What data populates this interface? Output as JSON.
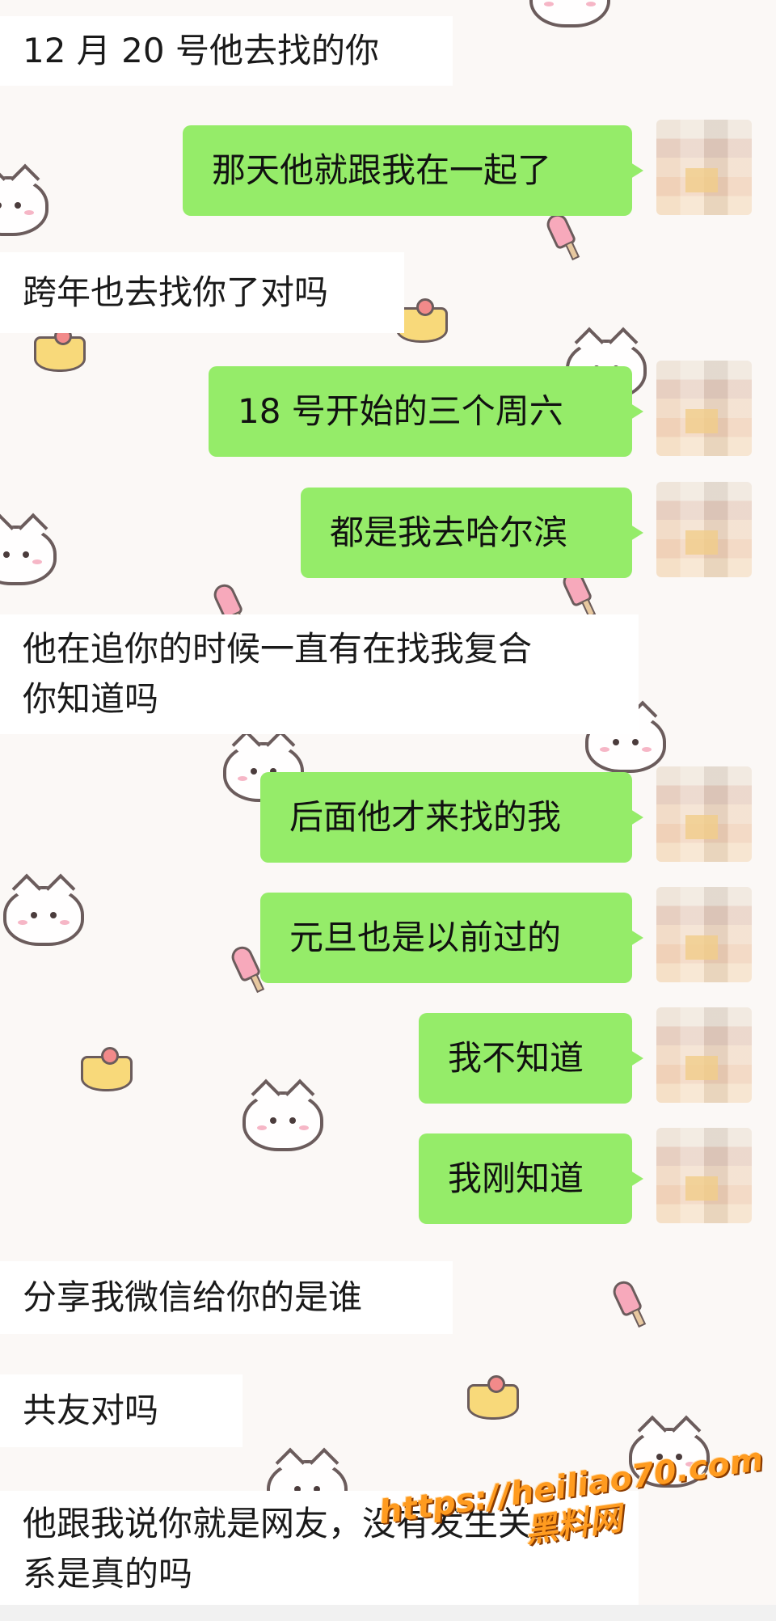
{
  "messages": {
    "m1": "12 月 20 号他去找的你",
    "m2": "那天他就跟我在一起了",
    "m3": "跨年也去找你了对吗",
    "m4": "18 号开始的三个周六",
    "m5": "都是我去哈尔滨",
    "m6_line1": "他在追你的时候一直有在找我复合",
    "m6_line2": "你知道吗",
    "m7": "后面他才来找的我",
    "m8": "元旦也是以前过的",
    "m9": "我不知道",
    "m10": "我刚知道",
    "m11": "分享我微信给你的是谁",
    "m12": "共友对吗",
    "m13_line1": "他跟我说你就是网友，没有发生关",
    "m13_line2": "系是真的吗"
  },
  "watermark": {
    "url": "https://heiliao70.com",
    "site": "黑料网"
  },
  "colors": {
    "outgoing_bubble": "#95ec69",
    "incoming_row": "#ffffff",
    "background": "#fbf8f6",
    "watermark": "#ff9b1f"
  },
  "icons": [
    "cat-sticker-icon",
    "pudding-sticker-icon",
    "popsicle-sticker-icon",
    "avatar-icon"
  ]
}
